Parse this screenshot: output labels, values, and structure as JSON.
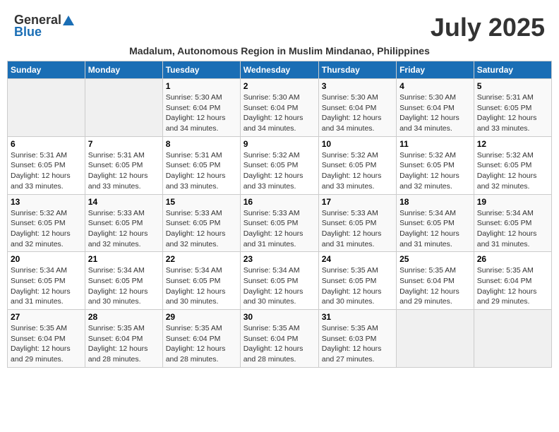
{
  "header": {
    "logo_general": "General",
    "logo_blue": "Blue",
    "month_year": "July 2025",
    "subtitle": "Madalum, Autonomous Region in Muslim Mindanao, Philippines"
  },
  "weekdays": [
    "Sunday",
    "Monday",
    "Tuesday",
    "Wednesday",
    "Thursday",
    "Friday",
    "Saturday"
  ],
  "weeks": [
    [
      {
        "day": "",
        "info": ""
      },
      {
        "day": "",
        "info": ""
      },
      {
        "day": "1",
        "info": "Sunrise: 5:30 AM\nSunset: 6:04 PM\nDaylight: 12 hours and 34 minutes."
      },
      {
        "day": "2",
        "info": "Sunrise: 5:30 AM\nSunset: 6:04 PM\nDaylight: 12 hours and 34 minutes."
      },
      {
        "day": "3",
        "info": "Sunrise: 5:30 AM\nSunset: 6:04 PM\nDaylight: 12 hours and 34 minutes."
      },
      {
        "day": "4",
        "info": "Sunrise: 5:30 AM\nSunset: 6:04 PM\nDaylight: 12 hours and 34 minutes."
      },
      {
        "day": "5",
        "info": "Sunrise: 5:31 AM\nSunset: 6:05 PM\nDaylight: 12 hours and 33 minutes."
      }
    ],
    [
      {
        "day": "6",
        "info": "Sunrise: 5:31 AM\nSunset: 6:05 PM\nDaylight: 12 hours and 33 minutes."
      },
      {
        "day": "7",
        "info": "Sunrise: 5:31 AM\nSunset: 6:05 PM\nDaylight: 12 hours and 33 minutes."
      },
      {
        "day": "8",
        "info": "Sunrise: 5:31 AM\nSunset: 6:05 PM\nDaylight: 12 hours and 33 minutes."
      },
      {
        "day": "9",
        "info": "Sunrise: 5:32 AM\nSunset: 6:05 PM\nDaylight: 12 hours and 33 minutes."
      },
      {
        "day": "10",
        "info": "Sunrise: 5:32 AM\nSunset: 6:05 PM\nDaylight: 12 hours and 33 minutes."
      },
      {
        "day": "11",
        "info": "Sunrise: 5:32 AM\nSunset: 6:05 PM\nDaylight: 12 hours and 32 minutes."
      },
      {
        "day": "12",
        "info": "Sunrise: 5:32 AM\nSunset: 6:05 PM\nDaylight: 12 hours and 32 minutes."
      }
    ],
    [
      {
        "day": "13",
        "info": "Sunrise: 5:32 AM\nSunset: 6:05 PM\nDaylight: 12 hours and 32 minutes."
      },
      {
        "day": "14",
        "info": "Sunrise: 5:33 AM\nSunset: 6:05 PM\nDaylight: 12 hours and 32 minutes."
      },
      {
        "day": "15",
        "info": "Sunrise: 5:33 AM\nSunset: 6:05 PM\nDaylight: 12 hours and 32 minutes."
      },
      {
        "day": "16",
        "info": "Sunrise: 5:33 AM\nSunset: 6:05 PM\nDaylight: 12 hours and 31 minutes."
      },
      {
        "day": "17",
        "info": "Sunrise: 5:33 AM\nSunset: 6:05 PM\nDaylight: 12 hours and 31 minutes."
      },
      {
        "day": "18",
        "info": "Sunrise: 5:34 AM\nSunset: 6:05 PM\nDaylight: 12 hours and 31 minutes."
      },
      {
        "day": "19",
        "info": "Sunrise: 5:34 AM\nSunset: 6:05 PM\nDaylight: 12 hours and 31 minutes."
      }
    ],
    [
      {
        "day": "20",
        "info": "Sunrise: 5:34 AM\nSunset: 6:05 PM\nDaylight: 12 hours and 31 minutes."
      },
      {
        "day": "21",
        "info": "Sunrise: 5:34 AM\nSunset: 6:05 PM\nDaylight: 12 hours and 30 minutes."
      },
      {
        "day": "22",
        "info": "Sunrise: 5:34 AM\nSunset: 6:05 PM\nDaylight: 12 hours and 30 minutes."
      },
      {
        "day": "23",
        "info": "Sunrise: 5:34 AM\nSunset: 6:05 PM\nDaylight: 12 hours and 30 minutes."
      },
      {
        "day": "24",
        "info": "Sunrise: 5:35 AM\nSunset: 6:05 PM\nDaylight: 12 hours and 30 minutes."
      },
      {
        "day": "25",
        "info": "Sunrise: 5:35 AM\nSunset: 6:04 PM\nDaylight: 12 hours and 29 minutes."
      },
      {
        "day": "26",
        "info": "Sunrise: 5:35 AM\nSunset: 6:04 PM\nDaylight: 12 hours and 29 minutes."
      }
    ],
    [
      {
        "day": "27",
        "info": "Sunrise: 5:35 AM\nSunset: 6:04 PM\nDaylight: 12 hours and 29 minutes."
      },
      {
        "day": "28",
        "info": "Sunrise: 5:35 AM\nSunset: 6:04 PM\nDaylight: 12 hours and 28 minutes."
      },
      {
        "day": "29",
        "info": "Sunrise: 5:35 AM\nSunset: 6:04 PM\nDaylight: 12 hours and 28 minutes."
      },
      {
        "day": "30",
        "info": "Sunrise: 5:35 AM\nSunset: 6:04 PM\nDaylight: 12 hours and 28 minutes."
      },
      {
        "day": "31",
        "info": "Sunrise: 5:35 AM\nSunset: 6:03 PM\nDaylight: 12 hours and 27 minutes."
      },
      {
        "day": "",
        "info": ""
      },
      {
        "day": "",
        "info": ""
      }
    ]
  ]
}
